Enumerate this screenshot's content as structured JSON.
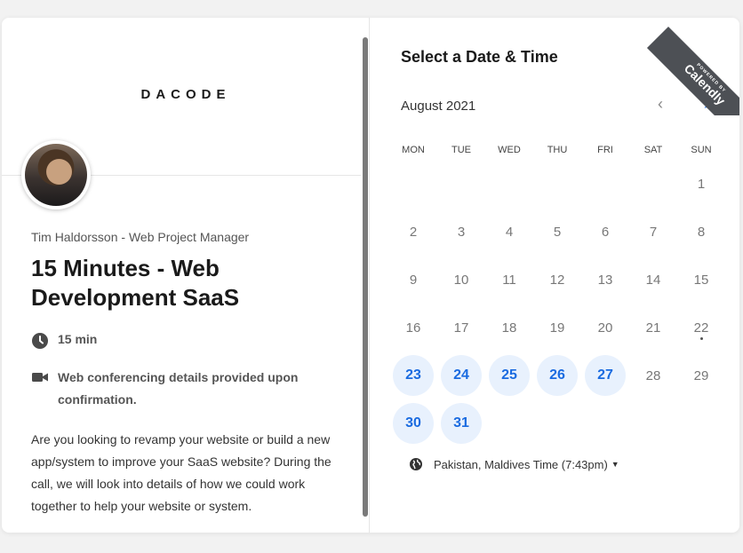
{
  "left": {
    "logo": "DACODE",
    "host": "Tim Haldorsson - Web Project Manager",
    "title": "15 Minutes - Web Development SaaS",
    "duration": "15 min",
    "conferencing": "Web conferencing details provided upon confirmation.",
    "description": "Are you looking to revamp your website or build a new app/system to improve your SaaS website? During the call, we will look into details of how we could work together to help your website or system."
  },
  "right": {
    "heading": "Select a Date & Time",
    "month": "August 2021",
    "prev": "‹",
    "next": "›",
    "weekdays": [
      "MON",
      "TUE",
      "WED",
      "THU",
      "FRI",
      "SAT",
      "SUN"
    ],
    "days": [
      {
        "d": "",
        "avail": false
      },
      {
        "d": "",
        "avail": false
      },
      {
        "d": "",
        "avail": false
      },
      {
        "d": "",
        "avail": false
      },
      {
        "d": "",
        "avail": false
      },
      {
        "d": "",
        "avail": false
      },
      {
        "d": "1",
        "avail": false
      },
      {
        "d": "2",
        "avail": false
      },
      {
        "d": "3",
        "avail": false
      },
      {
        "d": "4",
        "avail": false
      },
      {
        "d": "5",
        "avail": false
      },
      {
        "d": "6",
        "avail": false
      },
      {
        "d": "7",
        "avail": false
      },
      {
        "d": "8",
        "avail": false
      },
      {
        "d": "9",
        "avail": false
      },
      {
        "d": "10",
        "avail": false
      },
      {
        "d": "11",
        "avail": false
      },
      {
        "d": "12",
        "avail": false
      },
      {
        "d": "13",
        "avail": false
      },
      {
        "d": "14",
        "avail": false
      },
      {
        "d": "15",
        "avail": false
      },
      {
        "d": "16",
        "avail": false
      },
      {
        "d": "17",
        "avail": false
      },
      {
        "d": "18",
        "avail": false
      },
      {
        "d": "19",
        "avail": false
      },
      {
        "d": "20",
        "avail": false
      },
      {
        "d": "21",
        "avail": false
      },
      {
        "d": "22",
        "avail": false,
        "today": true
      },
      {
        "d": "23",
        "avail": true
      },
      {
        "d": "24",
        "avail": true
      },
      {
        "d": "25",
        "avail": true
      },
      {
        "d": "26",
        "avail": true
      },
      {
        "d": "27",
        "avail": true
      },
      {
        "d": "28",
        "avail": false
      },
      {
        "d": "29",
        "avail": false
      },
      {
        "d": "30",
        "avail": true
      },
      {
        "d": "31",
        "avail": true
      }
    ],
    "timezone": "Pakistan, Maldives Time (7:43pm)"
  },
  "ribbon": {
    "small": "POWERED BY",
    "big": "Calendly"
  },
  "colors": {
    "accent": "#1a6be0",
    "available_bg": "#e8f1fd",
    "ribbon": "#4d5055"
  }
}
